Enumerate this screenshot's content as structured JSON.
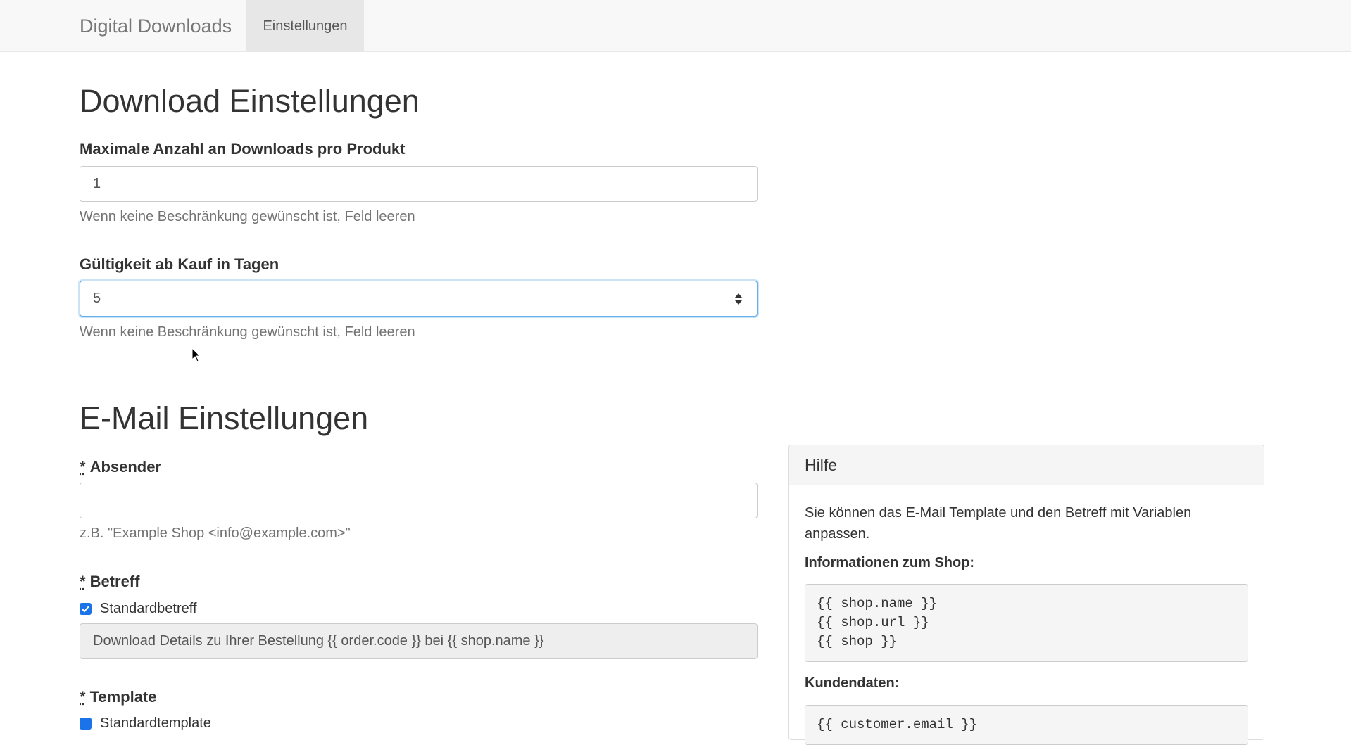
{
  "navbar": {
    "brand": "Digital Downloads",
    "tab": "Einstellungen"
  },
  "download_section": {
    "title": "Download Einstellungen",
    "max_downloads": {
      "label": "Maximale Anzahl an Downloads pro Produkt",
      "value": "1",
      "help": "Wenn keine Beschränkung gewünscht ist, Feld leeren"
    },
    "validity_days": {
      "label": "Gültigkeit ab Kauf in Tagen",
      "value": "5",
      "help": "Wenn keine Beschränkung gewünscht ist, Feld leeren"
    }
  },
  "email_section": {
    "title": "E-Mail Einstellungen",
    "required_marker": "*",
    "sender": {
      "label": "Absender",
      "value": "",
      "help": "z.B. \"Example Shop <info@example.com>\""
    },
    "subject": {
      "label": "Betreff",
      "checkbox_label": "Standardbetreff",
      "checked": true,
      "value": "Download Details zu Ihrer Bestellung {{ order.code }} bei {{ shop.name }}"
    },
    "template": {
      "label": "Template",
      "checkbox_label": "Standardtemplate",
      "checked": true
    }
  },
  "help_panel": {
    "title": "Hilfe",
    "intro": "Sie können das E-Mail Template und den Betreff mit Variablen anpassen.",
    "shop_heading": "Informationen zum Shop:",
    "shop_vars": [
      "{{ shop.name }}",
      "{{ shop.url }}",
      "{{ shop }}"
    ],
    "customer_heading": "Kundendaten:",
    "customer_vars": [
      "{{ customer.email }}"
    ]
  },
  "colors": {
    "accent": "#66afe9",
    "checkbox": "#1a73e8",
    "navbar_bg": "#f8f8f8"
  }
}
